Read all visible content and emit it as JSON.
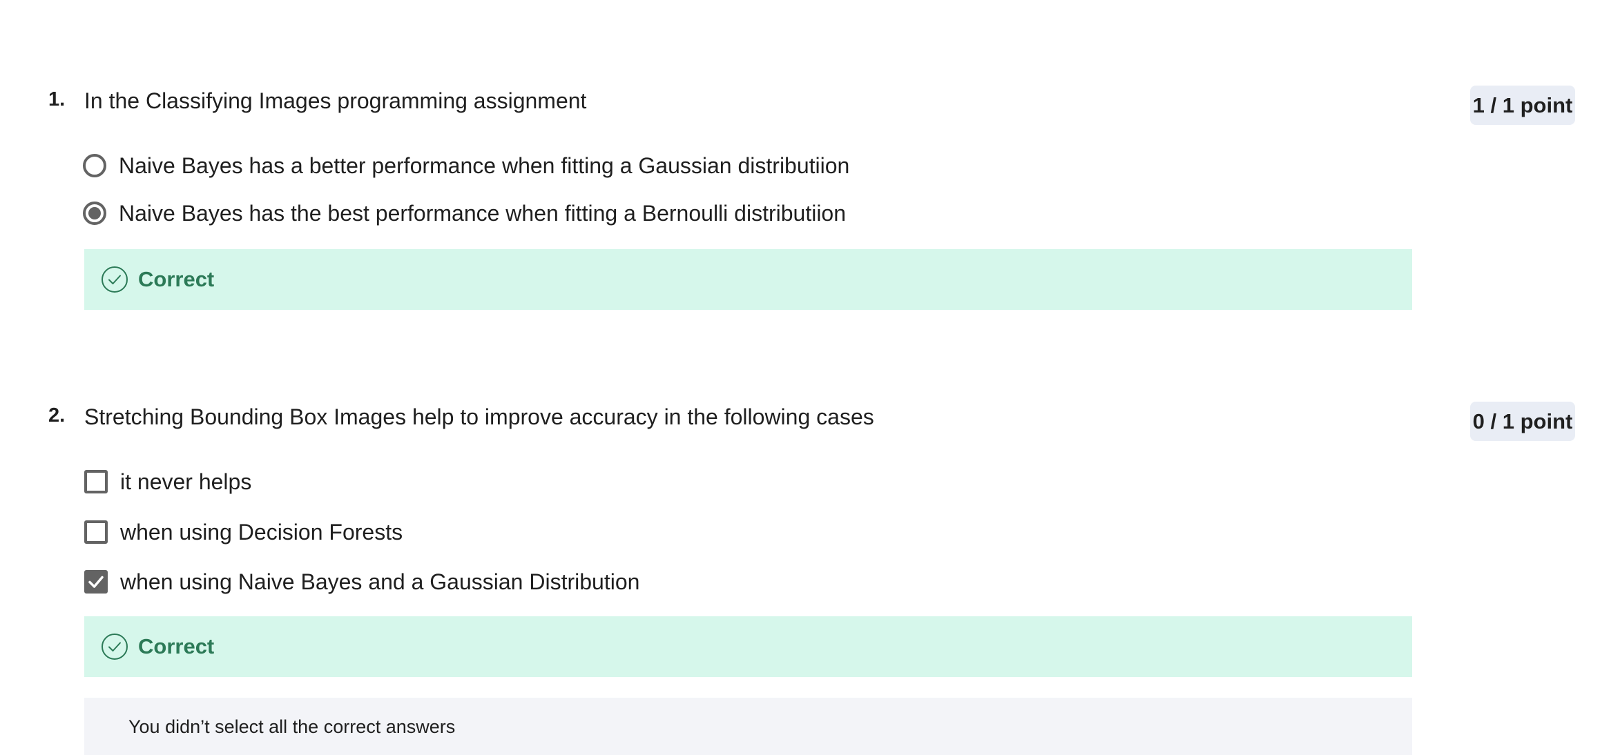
{
  "questions": [
    {
      "number": "1.",
      "text": "In the Classifying Images programming assignment",
      "points": "1 / 1 point",
      "type": "radio",
      "options": [
        {
          "label": "Naive Bayes has a better performance when fitting a Gaussian distributiion",
          "selected": false
        },
        {
          "label": "Naive Bayes has the best performance when fitting a Bernoulli distributiion",
          "selected": true
        }
      ],
      "feedback": {
        "status": "Correct",
        "icon": "check-circle-icon"
      }
    },
    {
      "number": "2.",
      "text": "Stretching Bounding Box Images help to improve accuracy in the following cases",
      "points": "0 / 1 point",
      "type": "checkbox",
      "options": [
        {
          "label": "it never helps",
          "selected": false
        },
        {
          "label": "when using Decision Forests",
          "selected": false
        },
        {
          "label": "when using Naive Bayes and a Gaussian Distribution",
          "selected": true
        }
      ],
      "feedback": {
        "status": "Correct",
        "icon": "check-circle-icon"
      },
      "note": "You didn’t select all the correct answers"
    }
  ],
  "colors": {
    "correct_bg": "#d6f7eb",
    "correct_text": "#2c7a57",
    "points_badge_bg": "#e9edf5",
    "note_bg": "#f3f4f8",
    "control_gray": "#636363"
  }
}
